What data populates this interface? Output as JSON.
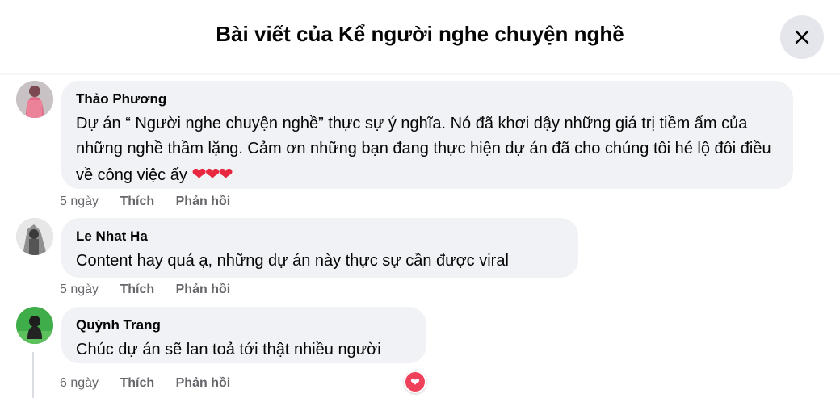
{
  "header": {
    "title": "Bài viết của Kể người nghe chuyện nghề",
    "close_icon": "close-icon"
  },
  "comments": [
    {
      "author": "Thảo Phương",
      "text": "Dự án “ Người nghe chuyện nghề” thực sự ý nghĩa. Nó đã khơi dậy những giá trị tiềm ẩm của những nghề thầm lặng. Cảm ơn những bạn đang thực hiện dự án đã cho chúng tôi hé lộ đôi điều về công việc ấy",
      "emoji": "❤❤❤",
      "time": "5 ngày",
      "like_label": "Thích",
      "reply_label": "Phản hồi"
    },
    {
      "author": "Le Nhat Ha",
      "text": "Content hay quá ạ, những dự án này thực sự cần được viral",
      "time": "5 ngày",
      "like_label": "Thích",
      "reply_label": "Phản hồi"
    },
    {
      "author": "Quỳnh Trang",
      "text": "Chúc dự án sẽ lan toả tới thật nhiều người",
      "time": "6 ngày",
      "like_label": "Thích",
      "reply_label": "Phản hồi",
      "reaction_icon": "love-reaction-icon"
    }
  ],
  "colors": {
    "bubble": "#f0f2f5",
    "meta": "#65676b",
    "heart": "#f0415a"
  }
}
